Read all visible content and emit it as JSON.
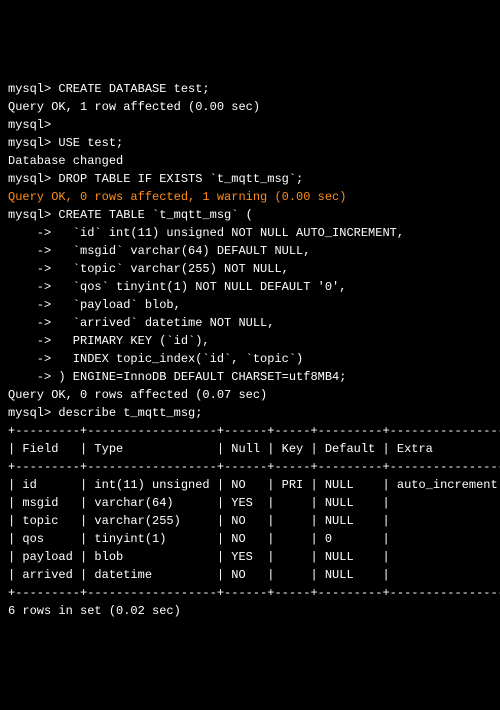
{
  "lines": [
    {
      "text": "mysql> CREATE DATABASE test;",
      "cls": ""
    },
    {
      "text": "Query OK, 1 row affected (0.00 sec)",
      "cls": ""
    },
    {
      "text": "",
      "cls": ""
    },
    {
      "text": "mysql>",
      "cls": ""
    },
    {
      "text": "mysql> USE test;",
      "cls": ""
    },
    {
      "text": "Database changed",
      "cls": ""
    },
    {
      "text": "mysql> DROP TABLE IF EXISTS `t_mqtt_msg`;",
      "cls": ""
    },
    {
      "text": "Query OK, 0 rows affected, 1 warning (0.00 sec)",
      "cls": "orange"
    },
    {
      "text": "",
      "cls": ""
    },
    {
      "text": "mysql> CREATE TABLE `t_mqtt_msg` (",
      "cls": ""
    },
    {
      "text": "    ->   `id` int(11) unsigned NOT NULL AUTO_INCREMENT,",
      "cls": ""
    },
    {
      "text": "    ->   `msgid` varchar(64) DEFAULT NULL,",
      "cls": ""
    },
    {
      "text": "    ->   `topic` varchar(255) NOT NULL,",
      "cls": ""
    },
    {
      "text": "    ->   `qos` tinyint(1) NOT NULL DEFAULT '0',",
      "cls": ""
    },
    {
      "text": "    ->   `payload` blob,",
      "cls": ""
    },
    {
      "text": "    ->   `arrived` datetime NOT NULL,",
      "cls": ""
    },
    {
      "text": "    ->   PRIMARY KEY (`id`),",
      "cls": ""
    },
    {
      "text": "    ->   INDEX topic_index(`id`, `topic`)",
      "cls": ""
    },
    {
      "text": "    -> ) ENGINE=InnoDB DEFAULT CHARSET=utf8MB4;",
      "cls": ""
    },
    {
      "text": "Query OK, 0 rows affected (0.07 sec)",
      "cls": ""
    },
    {
      "text": "",
      "cls": ""
    },
    {
      "text": "mysql> describe t_mqtt_msg;",
      "cls": ""
    },
    {
      "text": "+---------+------------------+------+-----+---------+----------------+",
      "cls": ""
    },
    {
      "text": "| Field   | Type             | Null | Key | Default | Extra          |",
      "cls": ""
    },
    {
      "text": "+---------+------------------+------+-----+---------+----------------+",
      "cls": ""
    },
    {
      "text": "| id      | int(11) unsigned | NO   | PRI | NULL    | auto_increment |",
      "cls": ""
    },
    {
      "text": "| msgid   | varchar(64)      | YES  |     | NULL    |                |",
      "cls": ""
    },
    {
      "text": "| topic   | varchar(255)     | NO   |     | NULL    |                |",
      "cls": ""
    },
    {
      "text": "| qos     | tinyint(1)       | NO   |     | 0       |                |",
      "cls": ""
    },
    {
      "text": "| payload | blob             | YES  |     | NULL    |                |",
      "cls": ""
    },
    {
      "text": "| arrived | datetime         | NO   |     | NULL    |                |",
      "cls": ""
    },
    {
      "text": "+---------+------------------+------+-----+---------+----------------+",
      "cls": ""
    },
    {
      "text": "6 rows in set (0.02 sec)",
      "cls": ""
    }
  ],
  "describe_table": {
    "columns": [
      "Field",
      "Type",
      "Null",
      "Key",
      "Default",
      "Extra"
    ],
    "rows": [
      {
        "Field": "id",
        "Type": "int(11) unsigned",
        "Null": "NO",
        "Key": "PRI",
        "Default": "NULL",
        "Extra": "auto_increment"
      },
      {
        "Field": "msgid",
        "Type": "varchar(64)",
        "Null": "YES",
        "Key": "",
        "Default": "NULL",
        "Extra": ""
      },
      {
        "Field": "topic",
        "Type": "varchar(255)",
        "Null": "NO",
        "Key": "",
        "Default": "NULL",
        "Extra": ""
      },
      {
        "Field": "qos",
        "Type": "tinyint(1)",
        "Null": "NO",
        "Key": "",
        "Default": "0",
        "Extra": ""
      },
      {
        "Field": "payload",
        "Type": "blob",
        "Null": "YES",
        "Key": "",
        "Default": "NULL",
        "Extra": ""
      },
      {
        "Field": "arrived",
        "Type": "datetime",
        "Null": "NO",
        "Key": "",
        "Default": "NULL",
        "Extra": ""
      }
    ],
    "row_count_text": "6 rows in set (0.02 sec)"
  }
}
